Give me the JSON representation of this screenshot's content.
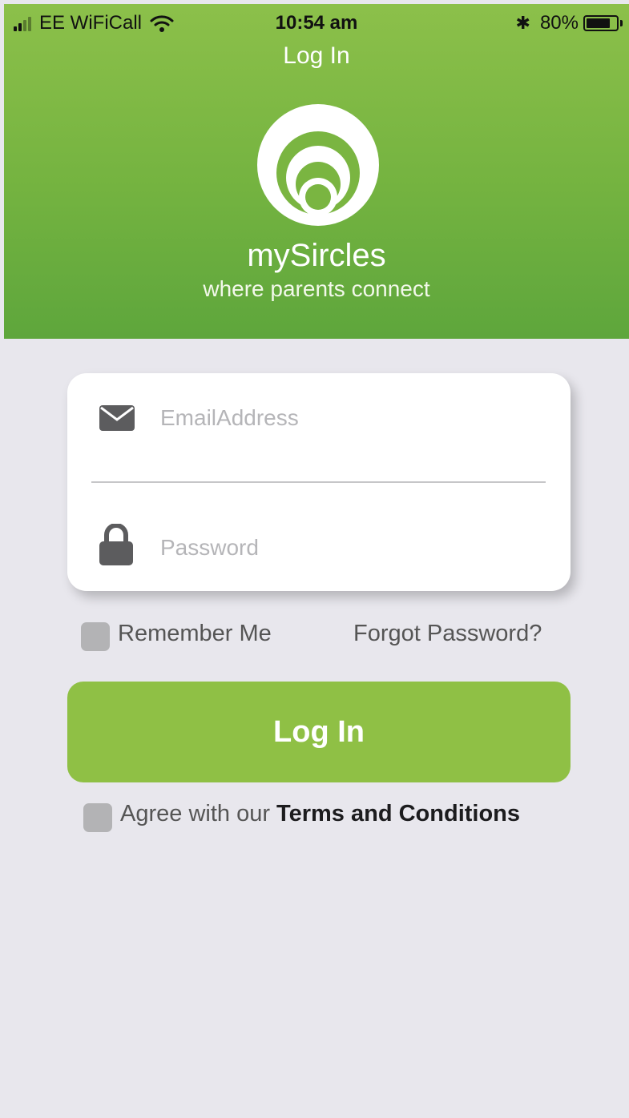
{
  "status_bar": {
    "carrier": "EE WiFiCall",
    "time": "10:54 am",
    "battery_percent": "80%",
    "battery_level": 0.8,
    "signal_bars_filled": 2,
    "signal_bars_total": 4
  },
  "header": {
    "title": "Log In",
    "brand_name": "mySircles",
    "tagline": "where parents connect"
  },
  "form": {
    "email_placeholder": "EmailAddress",
    "email_value": "",
    "password_placeholder": "Password",
    "password_value": ""
  },
  "options": {
    "remember_label": "Remember Me",
    "remember_checked": false,
    "forgot_label": "Forgot Password?"
  },
  "login_button_label": "Log In",
  "agreement": {
    "prefix": "Agree with our ",
    "link_label": "Terms and Conditions",
    "checked": false
  },
  "colors": {
    "header_green": "#74b340",
    "button_green": "#8fc045",
    "background": "#e8e7ed",
    "checkbox_gray": "#b3b3b5"
  },
  "icons": {
    "email": "envelope-icon",
    "password": "lock-icon",
    "logo": "mysircles-logo",
    "wifi": "wifi-icon",
    "bluetooth": "bluetooth-icon",
    "battery": "battery-icon"
  }
}
